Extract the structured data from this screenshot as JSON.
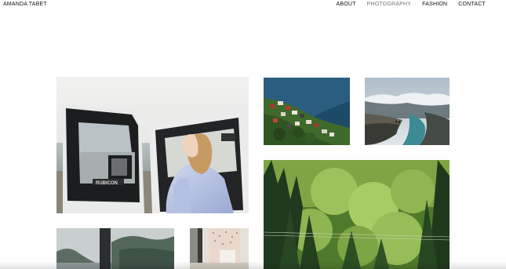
{
  "header": {
    "site_title": "AMANDA TABET",
    "nav": [
      {
        "label": "ABOUT"
      },
      {
        "label": "PHOTOGRAPHY"
      },
      {
        "label": "FASHION"
      },
      {
        "label": "CONTACT"
      }
    ],
    "active_nav": "PHOTOGRAPHY",
    "active_color": "#777777"
  },
  "gallery": {
    "photos": [
      {
        "subject": "woman-in-jeep",
        "jeep_badge": "RUBICON"
      },
      {
        "subject": "village-aerial"
      },
      {
        "subject": "fjord-cliff"
      },
      {
        "subject": "pine-forest"
      },
      {
        "subject": "misty-lake"
      },
      {
        "subject": "room-interior"
      }
    ]
  }
}
